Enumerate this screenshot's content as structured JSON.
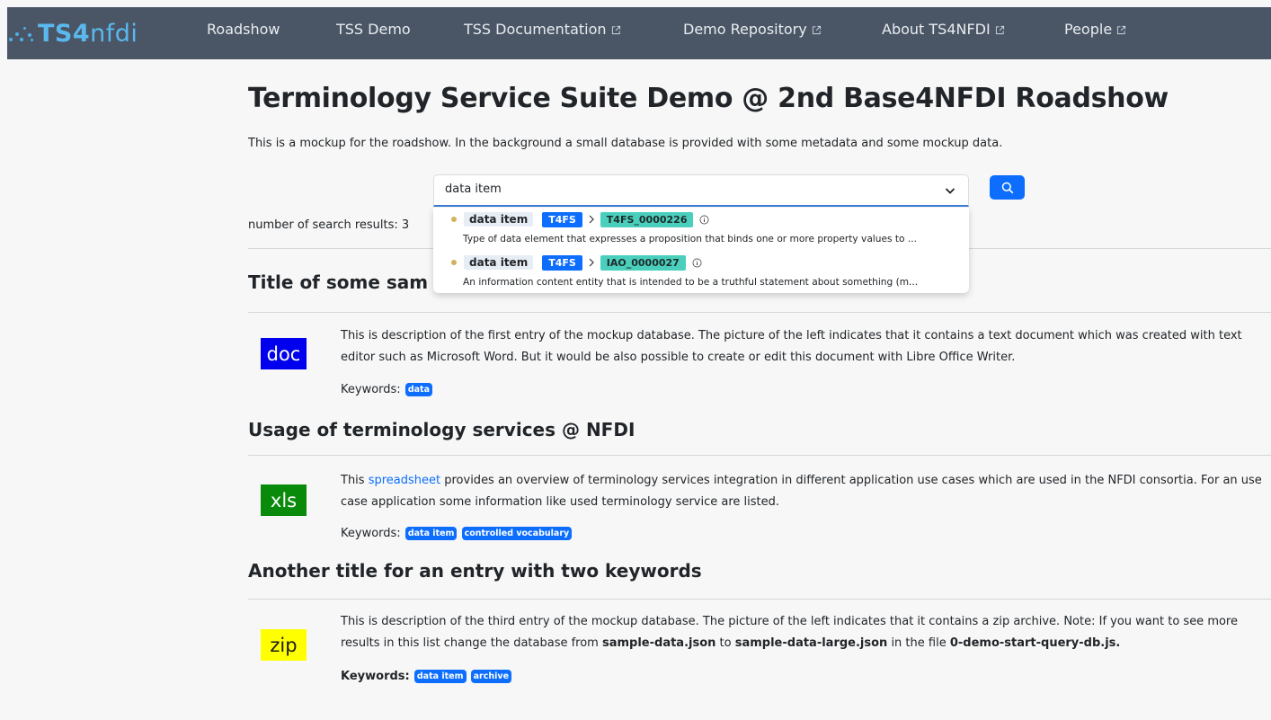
{
  "nav": {
    "brand": {
      "ts": "TS4",
      "n": "n",
      "fdi": "fdi"
    },
    "items": [
      {
        "label": "Roadshow",
        "external": false
      },
      {
        "label": "TSS Demo",
        "external": false
      },
      {
        "label": "TSS Documentation",
        "external": true
      },
      {
        "label": "Demo Repository",
        "external": true
      },
      {
        "label": "About TS4NFDI",
        "external": true
      },
      {
        "label": "People",
        "external": true
      }
    ]
  },
  "page": {
    "title": "Terminology Service Suite Demo @ 2nd Base4NFDI Roadshow",
    "subtitle": "This is a mockup for the roadshow. In the background a small database is provided with some metadata and some mockup data."
  },
  "search": {
    "value": "data item",
    "results_label": "number of search results: 3",
    "suggestions": [
      {
        "label": "data item",
        "ontology": "T4FS",
        "id": "T4FS_0000226",
        "description": "Type of data element that expresses a proposition that binds one or more property values to ..."
      },
      {
        "label": "data item",
        "ontology": "T4FS",
        "id": "IAO_0000027",
        "description": "An information content entity that is intended to be a truthful statement about something (m..."
      }
    ]
  },
  "results": [
    {
      "title": "Title of some sam",
      "icon": "doc",
      "icon_bg": "#0000ee",
      "icon_fg": "#ffffff",
      "description_before": "This is description of the first entry of the mockup database. The picture of the left indicates that it contains a text document which was created with text editor such as Microsoft Word. But it would be also possible to create or edit this document with Libre Office Writer.",
      "keywords_label": "Keywords:",
      "keywords": [
        "data"
      ]
    },
    {
      "title": "Usage of terminology services @ NFDI",
      "icon": "xls",
      "icon_bg": "#0a8a0a",
      "icon_fg": "#ffffff",
      "description_before": "This ",
      "description_link": "spreadsheet",
      "description_after": " provides an overview of terminology services integration in different application use cases which are used in the NFDI consortia. For an use case application some information like used terminology service are listed.",
      "keywords_label": "Keywords:",
      "keywords": [
        "data item",
        "controlled vocabulary"
      ]
    },
    {
      "title": "Another title for an entry with two keywords",
      "icon": "zip",
      "icon_bg": "#ffff00",
      "icon_fg": "#1a1a1a",
      "description_before": "This is description of the third entry of the mockup database. The picture of the left indicates that it contains a zip archive. Note: If you want to see more results in this list change the database from ",
      "description_bold1": "sample-data.json",
      "description_mid": " to ",
      "description_bold2": "sample-data-large.json",
      "description_mid2": " in the file ",
      "description_bold3": "0-demo-start-query-db.js.",
      "keywords_label": "Keywords:",
      "keywords": [
        "data item",
        "archive"
      ]
    }
  ],
  "colors": {
    "navbar": "#4a5666",
    "brand": "#5bb8ef",
    "primary": "#0d6efd",
    "id_chip": "#4bcfbd",
    "dot": "#d1b25d"
  }
}
